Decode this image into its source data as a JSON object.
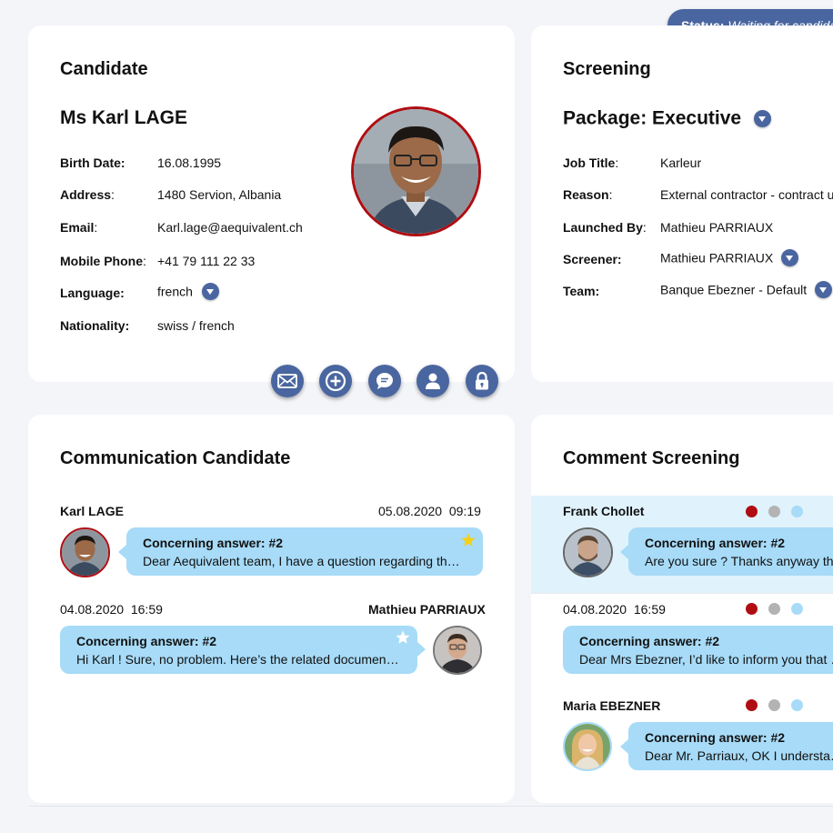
{
  "status": {
    "label": "Status:",
    "value": "Waiting for candidate"
  },
  "candidate": {
    "title": "Candidate",
    "name": "Ms Karl LAGE",
    "fields": {
      "birth_date": {
        "label": "Birth Date:",
        "value": "16.08.1995"
      },
      "address": {
        "label": "Address",
        "value": "1480 Servion, Albania"
      },
      "email": {
        "label": "Email",
        "value": "Karl.lage@aequivalent.ch"
      },
      "mobile": {
        "label": "Mobile Phone",
        "value": "+41 79 111 22 33"
      },
      "language": {
        "label": "Language:",
        "value": "french"
      },
      "nationality": {
        "label": "Nationality:",
        "value": "swiss / french"
      }
    },
    "actions": [
      "mail-icon",
      "plus-icon",
      "chat-icon",
      "person-icon",
      "lock-icon"
    ]
  },
  "screening": {
    "title": "Screening",
    "package": "Package: Executive",
    "fields": {
      "job_title": {
        "label": "Job Title",
        "value": "Karleur"
      },
      "reason": {
        "label": "Reason",
        "value": "External contractor - contract update"
      },
      "launched_by": {
        "label": "Launched By",
        "value": "Mathieu PARRIAUX"
      },
      "screener": {
        "label": "Screener:",
        "value": "Mathieu PARRIAUX"
      },
      "team": {
        "label": "Team:",
        "value": "Banque Ebezner - Default"
      }
    }
  },
  "communication": {
    "title": "Communication Candidate",
    "messages": [
      {
        "sender": "Karl LAGE",
        "date": "05.08.2020",
        "time": "09:19",
        "subject": "Concerning answer: #2",
        "text": "Dear Aequivalent team, I have a question regarding the…",
        "starred": true
      },
      {
        "sender": "Mathieu PARRIAUX",
        "date": "04.08.2020",
        "time": "16:59",
        "subject": "Concerning answer: #2",
        "text": "Hi Karl ! Sure, no problem. Here’s the related document…",
        "starred": false
      }
    ]
  },
  "comments": {
    "title": "Comment Screening",
    "items": [
      {
        "sender": "Frank Chollet",
        "subject": "Concerning answer: #2",
        "text": "Are you sure ? Thanks anyway then."
      },
      {
        "date": "04.08.2020",
        "time": "16:59",
        "subject": "Concerning answer: #2",
        "text": "Dear Mrs Ebezner, I’d like to inform you that we"
      },
      {
        "sender": "Maria EBEZNER",
        "subject": "Concerning answer: #2",
        "text": "Dear Mr. Parriaux, OK I understand the"
      }
    ],
    "dot_colors": [
      "#b00d12",
      "#b3b3b3",
      "#a7dbf8"
    ]
  },
  "colors": {
    "accent": "#4a66a0",
    "bubble": "#a7dbf8",
    "avatar_ring": "#b00d12",
    "star_gold": "#f5d015"
  }
}
